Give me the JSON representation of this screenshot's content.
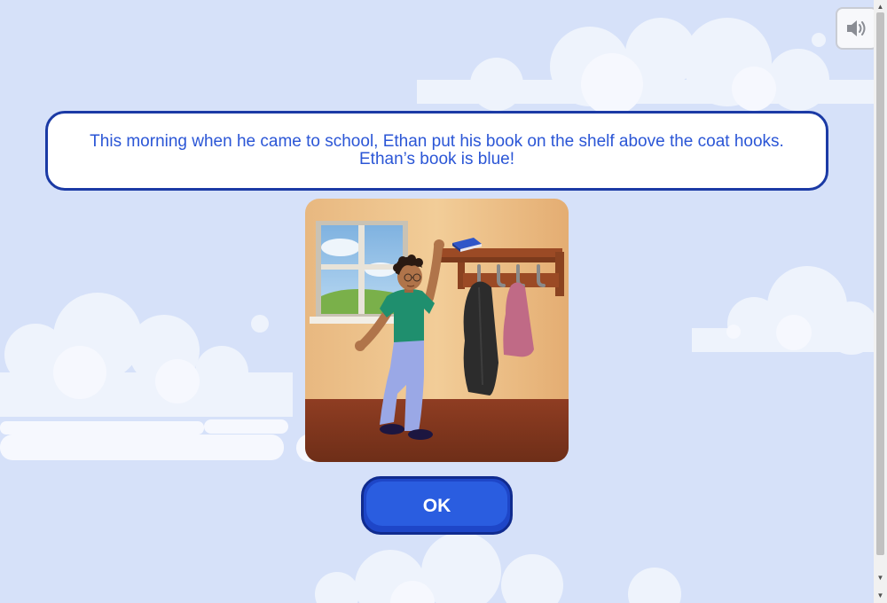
{
  "prompt": {
    "line1": "This morning when he came to school, Ethan put his book on the shelf above the coat hooks.",
    "line2": "Ethan’s book is blue!"
  },
  "ok_button": {
    "label": "OK"
  },
  "sound_button": {
    "icon": "speaker-icon"
  },
  "scene": {
    "description_icon": "classroom-illustration",
    "book_color": "#2f56c8"
  },
  "colors": {
    "background": "#d6e1f9",
    "prompt_text": "#2b56d6",
    "prompt_border": "#1b3aa5",
    "ok_button": "#2a5de0"
  }
}
